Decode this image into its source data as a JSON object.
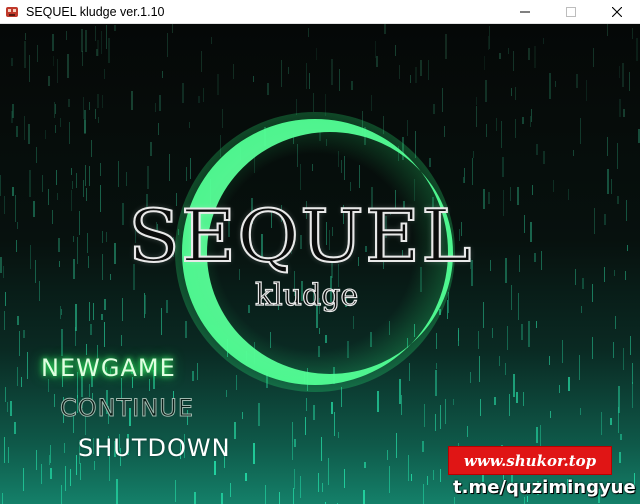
{
  "window": {
    "title": "SEQUEL kludge ver.1.10",
    "icon": "app-icon",
    "controls": [
      "minimize-icon",
      "maximize-icon",
      "close-icon"
    ]
  },
  "logo": {
    "title": "SEQUEL",
    "subtitle": "kludge",
    "ring_color": "#5cff9a"
  },
  "menu": {
    "items": [
      {
        "label": "NEWGAME",
        "state": "selected"
      },
      {
        "label": "CONTINUE",
        "state": "disabled"
      },
      {
        "label": "SHUTDOWN",
        "state": "normal"
      }
    ]
  },
  "watermark": {
    "site": "www.shukor.top",
    "handle": "t.me/quzimingyue"
  },
  "colors": {
    "accent": "#38ff6a",
    "watermark_bg": "#e01515"
  }
}
